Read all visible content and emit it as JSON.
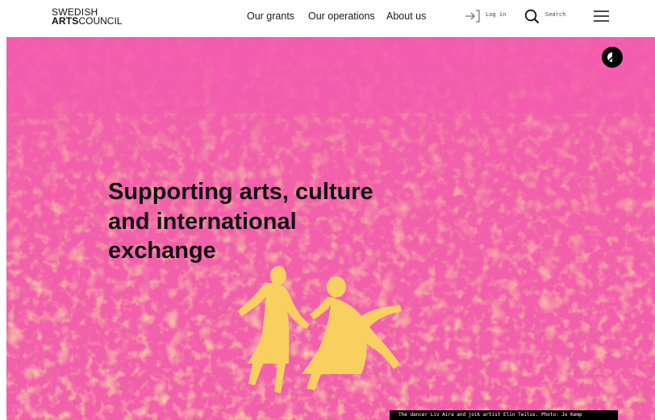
{
  "logo": {
    "line1": "SWEDISH",
    "line2_bold": "ARTS",
    "line2_rest": "COUNCIL"
  },
  "nav": {
    "grants": "Our grants",
    "operations": "Our operations",
    "about": "About us"
  },
  "utility": {
    "login": "Log in",
    "search": "Search"
  },
  "icons": {
    "login": "login-arrow-icon",
    "search": "search-icon",
    "menu": "hamburger-menu-icon",
    "contrast": "contrast-icon"
  },
  "hero": {
    "headline_lines": [
      "Supporting arts, culture",
      "and international",
      "exchange"
    ],
    "caption": "The dancer Liv Aira and joik artist Elin Teilus. Photo: Jo Kemp"
  },
  "colors": {
    "overlay_pink": "#f45fa9",
    "overlay_yellow": "#f7d35a",
    "text": "#111111"
  }
}
